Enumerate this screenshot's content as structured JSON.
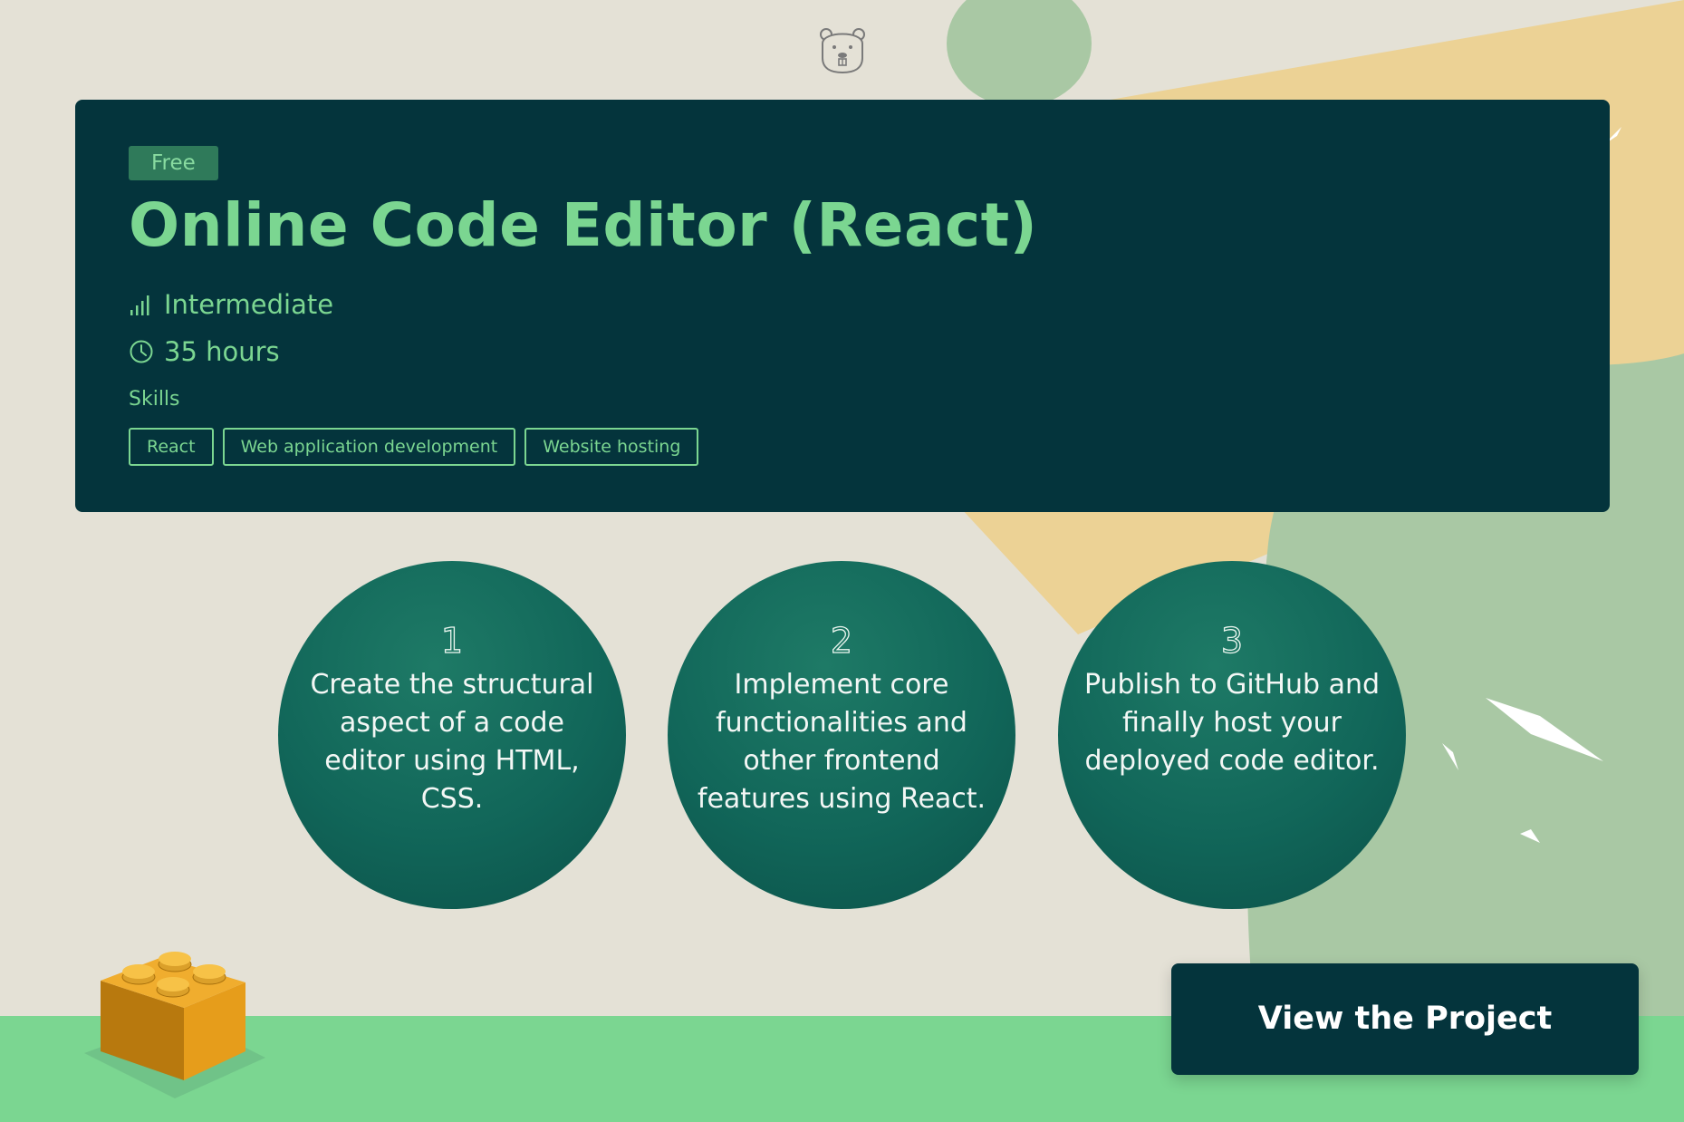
{
  "colors": {
    "background": "#e4e1d6",
    "card": "#04343c",
    "accent_green": "#7bd691",
    "badge_bg": "#2f7a5a",
    "circle_teal": "#116659",
    "ground": "#7bd691",
    "shape_sage": "#a9c8a4",
    "shape_sand": "#ecd295"
  },
  "header": {
    "mascot_icon": "beaver-icon"
  },
  "project": {
    "badge": "Free",
    "title": "Online Code Editor (React)",
    "level_icon": "signal-bars-icon",
    "level": "Intermediate",
    "duration_icon": "clock-icon",
    "duration": "35 hours",
    "skills_label": "Skills",
    "skills": [
      "React",
      "Web application development",
      "Website hosting"
    ]
  },
  "steps": [
    {
      "number": "1",
      "text": "Create the structural aspect of a code editor using HTML, CSS."
    },
    {
      "number": "2",
      "text": "Implement core functionalities and other frontend features using React."
    },
    {
      "number": "3",
      "text": "Publish to GitHub and finally host your deployed code editor."
    }
  ],
  "cta": {
    "label": "View the Project"
  },
  "decoration": {
    "brick_icon": "lego-brick-icon"
  }
}
